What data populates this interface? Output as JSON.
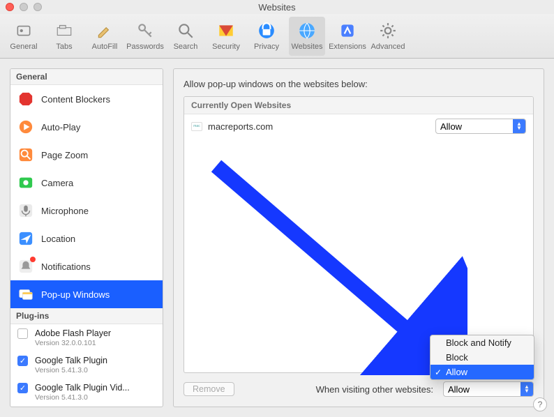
{
  "window": {
    "title": "Websites"
  },
  "toolbar": {
    "items": [
      {
        "label": "General"
      },
      {
        "label": "Tabs"
      },
      {
        "label": "AutoFill"
      },
      {
        "label": "Passwords"
      },
      {
        "label": "Search"
      },
      {
        "label": "Security"
      },
      {
        "label": "Privacy"
      },
      {
        "label": "Websites"
      },
      {
        "label": "Extensions"
      },
      {
        "label": "Advanced"
      }
    ],
    "selected_index": 7
  },
  "sidebar": {
    "sections": [
      {
        "header": "General",
        "items": [
          {
            "label": "Content Blockers"
          },
          {
            "label": "Auto-Play"
          },
          {
            "label": "Page Zoom"
          },
          {
            "label": "Camera"
          },
          {
            "label": "Microphone"
          },
          {
            "label": "Location"
          },
          {
            "label": "Notifications",
            "badge": true
          },
          {
            "label": "Pop-up Windows",
            "selected": true
          }
        ]
      },
      {
        "header": "Plug-ins",
        "items": [
          {
            "label": "Adobe Flash Player",
            "version": "Version 32.0.0.101",
            "checked": false
          },
          {
            "label": "Google Talk Plugin",
            "version": "Version 5.41.3.0",
            "checked": true
          },
          {
            "label": "Google Talk Plugin Vid...",
            "version": "Version 5.41.3.0",
            "checked": true
          }
        ]
      }
    ]
  },
  "main": {
    "heading": "Allow pop-up windows on the websites below:",
    "list_header": "Currently Open Websites",
    "sites": [
      {
        "name": "macreports.com",
        "policy": "Allow"
      }
    ],
    "remove_label": "Remove",
    "other_label": "When visiting other websites:",
    "other_policy": "Allow"
  },
  "policy_menu": {
    "options": [
      "Block and Notify",
      "Block",
      "Allow"
    ],
    "selected_index": 2
  }
}
